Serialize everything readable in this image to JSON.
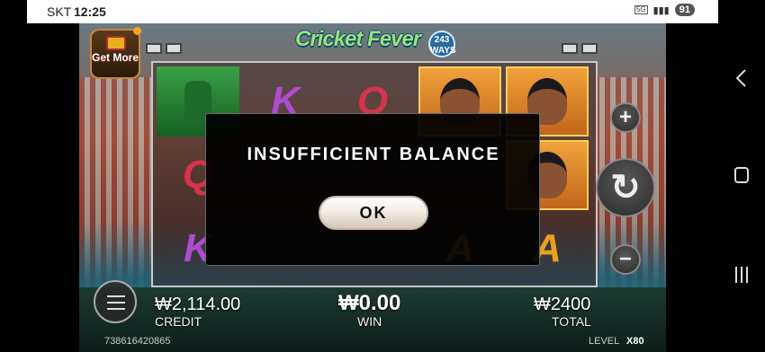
{
  "status_bar": {
    "carrier": "SKT",
    "time": "12:25",
    "network": "5G",
    "battery": "91"
  },
  "game": {
    "title": "Cricket Fever",
    "title_badge": "243 WAYS",
    "get_more": "Get More",
    "reels": [
      [
        "batsman",
        "K",
        "Q",
        "player",
        "player"
      ],
      [
        "Q",
        "",
        "",
        "",
        "player"
      ],
      [
        "K",
        "",
        "",
        "A",
        "A"
      ]
    ],
    "controls": {
      "plus": "+",
      "minus": "−",
      "spin": "↻"
    }
  },
  "bottom": {
    "credit_value": "₩2,114.00",
    "credit_label": "CREDIT",
    "win_value": "₩0.00",
    "win_label": "WIN",
    "total_value": "₩2400",
    "total_label": "TOTAL",
    "session_id": "738616420865",
    "level_label": "LEVEL",
    "level_value": "X80"
  },
  "dialog": {
    "message": "INSUFFICIENT BALANCE",
    "ok_label": "OK"
  },
  "colors": {
    "accent": "#f7a31c",
    "dialog_bg": "#000000",
    "ok_button": "#f3ebe3"
  }
}
